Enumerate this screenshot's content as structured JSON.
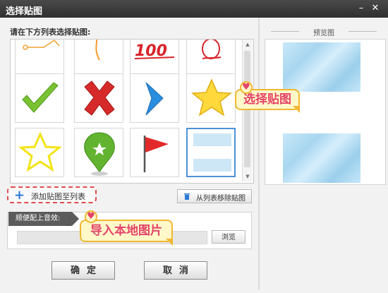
{
  "window": {
    "title": "选择贴图",
    "minimize_icon": "minimize-icon",
    "close_icon": "close-icon"
  },
  "list": {
    "prompt": "请在下方列表选择贴图:"
  },
  "stickers": [
    {
      "name": "sticker-line-circuit"
    },
    {
      "name": "sticker-curve-orange"
    },
    {
      "name": "sticker-100-red"
    },
    {
      "name": "sticker-scribble-red"
    },
    {
      "name": "sticker-checkmark-green"
    },
    {
      "name": "sticker-cross-red"
    },
    {
      "name": "sticker-chevron-blue"
    },
    {
      "name": "sticker-star-yellow"
    },
    {
      "name": "sticker-star-outline-yellow"
    },
    {
      "name": "sticker-map-pin-green"
    },
    {
      "name": "sticker-flag-red"
    },
    {
      "name": "sticker-frame-blue",
      "selected": true
    }
  ],
  "buttons": {
    "add": "添加贴图至列表",
    "remove": "从列表移除贴图",
    "browse": "浏览",
    "ok": "确定",
    "cancel": "取消"
  },
  "music": {
    "label": "顺便配上音效:",
    "value": ""
  },
  "preview": {
    "label": "预览图"
  },
  "annotations": {
    "select_sticker": "选择贴图",
    "import_local": "导入本地图片"
  },
  "colors": {
    "accent": "#e4446a",
    "callout_border": "#f1b731",
    "selection": "#4d90d6"
  }
}
